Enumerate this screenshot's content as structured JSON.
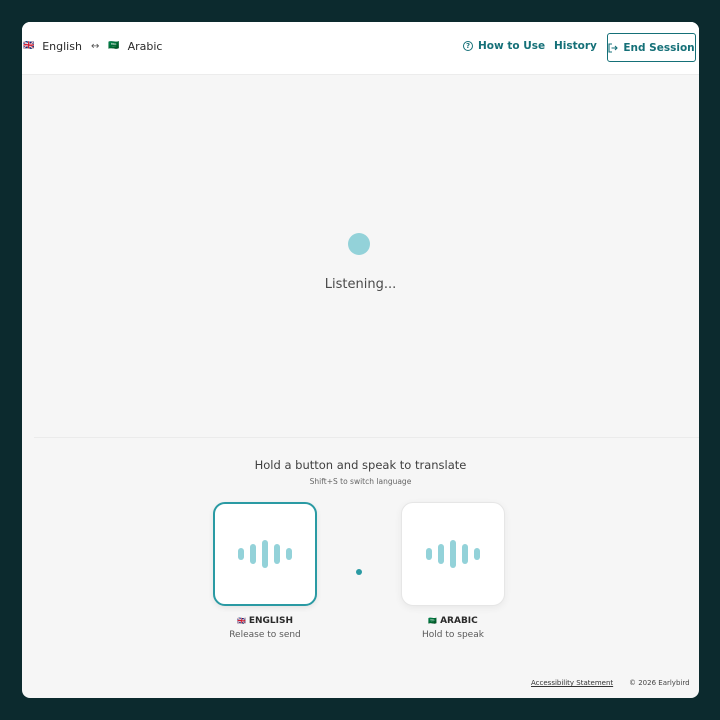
{
  "header": {
    "source_flag": "🇬🇧",
    "source_lang": "English",
    "swap_symbol": "↔",
    "target_flag": "🇸🇦",
    "target_lang": "Arabic",
    "help_icon": "?",
    "how_to_use": "How to Use",
    "history": "History",
    "end_session": "End Session"
  },
  "status": {
    "text": "Listening..."
  },
  "instructions": {
    "title": "Hold a button and speak to translate",
    "shortcut": "Shift+S to switch language"
  },
  "speakers": [
    {
      "flag": "🇬🇧",
      "label": "ENGLISH",
      "sub": "Release to send",
      "state": "active"
    },
    {
      "flag": "🇸🇦",
      "label": "ARABIC",
      "sub": "Hold to speak",
      "state": "idle"
    }
  ],
  "footer": {
    "accessibility": "Accessibility Statement",
    "copyright": "© 2026 Earlybird"
  },
  "colors": {
    "accent": "#157078",
    "wave": "#93d2d9",
    "background": "#0c2a2e",
    "panel": "#f6f6f6"
  }
}
